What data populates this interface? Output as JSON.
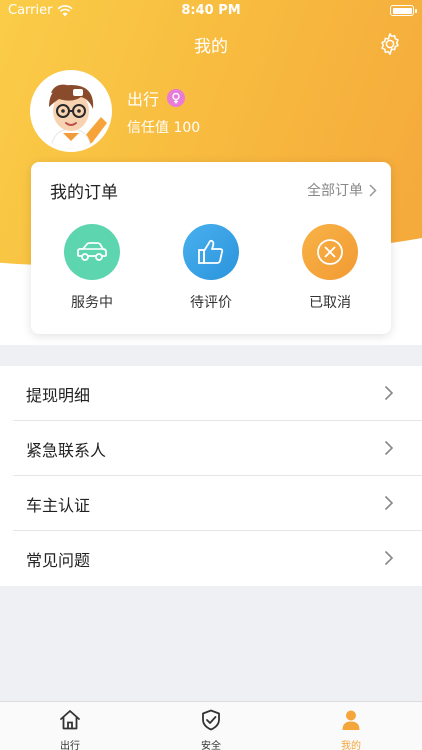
{
  "status_bar": {
    "carrier": "Carrier",
    "time": "8:40 PM"
  },
  "header": {
    "title": "我的"
  },
  "profile": {
    "name": "出行",
    "trust": "信任值 100"
  },
  "orders": {
    "title": "我的订单",
    "all_label": "全部订单",
    "items": [
      {
        "label": "服务中",
        "icon": "car-icon",
        "color": "#5dd6b0"
      },
      {
        "label": "待评价",
        "icon": "thumbs-up-icon",
        "color": "#3aa6e6"
      },
      {
        "label": "已取消",
        "icon": "cancel-icon",
        "color": "#f5a63b"
      }
    ]
  },
  "menu": {
    "items": [
      {
        "label": "提现明细"
      },
      {
        "label": "紧急联系人"
      },
      {
        "label": "车主认证"
      },
      {
        "label": "常见问题"
      }
    ]
  },
  "tabbar": {
    "items": [
      {
        "label": "出行",
        "icon": "home-icon",
        "active": false
      },
      {
        "label": "安全",
        "icon": "shield-icon",
        "active": false
      },
      {
        "label": "我的",
        "icon": "person-icon",
        "active": true
      }
    ],
    "active_color": "#f5a63b",
    "inactive_color": "#333333"
  }
}
